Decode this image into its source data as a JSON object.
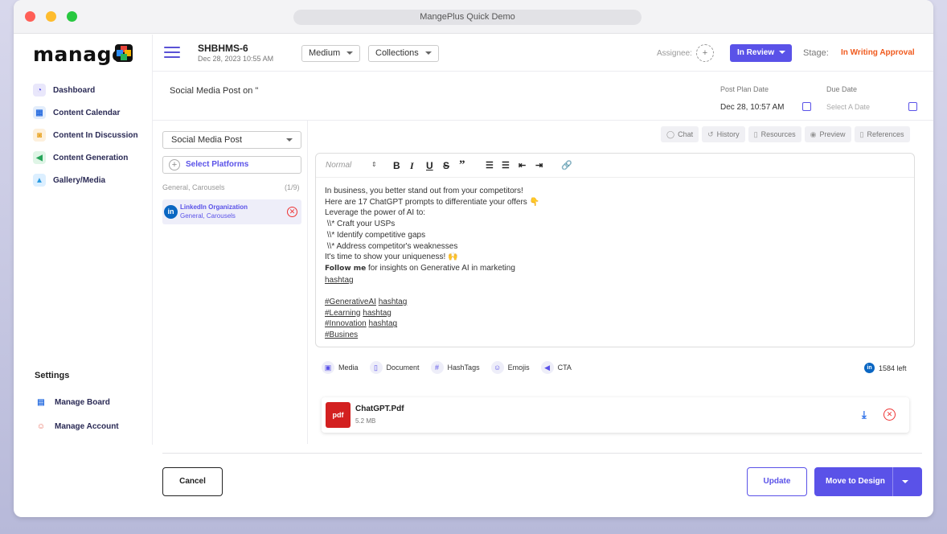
{
  "window": {
    "title": "MangePlus Quick Demo"
  },
  "logo": {
    "text": "manage"
  },
  "sidebar": {
    "items": [
      {
        "label": "Dashboard",
        "icon": "dashboard-icon"
      },
      {
        "label": "Content Calendar",
        "icon": "calendar-icon"
      },
      {
        "label": "Content In Discussion",
        "icon": "chat-bubbles-icon"
      },
      {
        "label": "Content Generation",
        "icon": "megaphone-icon"
      },
      {
        "label": "Gallery/Media",
        "icon": "image-icon"
      }
    ],
    "settings_title": "Settings",
    "settings_items": [
      {
        "label": "Manage Board",
        "icon": "board-icon"
      },
      {
        "label": "Manage Account",
        "icon": "users-icon"
      }
    ]
  },
  "header": {
    "doc_id": "SHBHMS-6",
    "doc_date": "Dec 28, 2023 10:55 AM",
    "priority": "Medium",
    "collection": "Collections",
    "assignee_label": "Assignee:",
    "status": "In Review",
    "stage_label": "Stage:",
    "stage_value": "In Writing Approval"
  },
  "post": {
    "title": "Social Media Post on \"",
    "post_plan_date_label": "Post Plan Date",
    "post_plan_date_value": "Dec 28, 10:57 AM",
    "due_date_label": "Due Date",
    "due_date_placeholder": "Select A Date"
  },
  "left_panel": {
    "content_type": "Social Media Post",
    "select_platforms": "Select Platforms",
    "group_label": "General, Carousels",
    "group_count": "(1/9)",
    "platform": {
      "name": "LinkedIn Organization",
      "sub": "General, Carousels"
    }
  },
  "tabs": [
    {
      "label": "Chat",
      "icon": "chat-icon"
    },
    {
      "label": "History",
      "icon": "history-icon"
    },
    {
      "label": "Resources",
      "icon": "file-icon"
    },
    {
      "label": "Preview",
      "icon": "eye-icon"
    },
    {
      "label": "References",
      "icon": "file-icon"
    }
  ],
  "editor": {
    "format": "Normal",
    "lines": [
      "In business, you better stand out from your competitors!",
      "Here are 17 ChatGPT prompts to differentiate your offers 👇",
      "Leverage the power of AI to:",
      " \\\\* Craft your USPs",
      " \\\\* Identify competitive gaps",
      " \\\\* Address competitor's weaknesses",
      "It's time to show your uniqueness! 🙌"
    ],
    "follow_bold": "Follow me",
    "follow_rest": " for insights on Generative AI in marketing",
    "hashtag_line": "hashtag",
    "tags": [
      {
        "tag": "#GenerativeAI",
        "suffix": "hashtag"
      },
      {
        "tag": "#Learning",
        "suffix": "hashtag"
      },
      {
        "tag": "#Innovation",
        "suffix": "hashtag"
      }
    ],
    "last_tag": "#Busines"
  },
  "attachments": {
    "media": "Media",
    "document": "Document",
    "hashtags": "HashTags",
    "emojis": "Emojis",
    "cta": "CTA",
    "chars_left": "1584 left"
  },
  "file": {
    "name": "ChatGPT.Pdf",
    "size": "5.2 MB",
    "badge": "pdf"
  },
  "footer": {
    "cancel": "Cancel",
    "update": "Update",
    "move": "Move to Design"
  },
  "colors": {
    "accent": "#5a52e8",
    "stage": "#f05a1e",
    "linkedin": "#0a66c2",
    "danger": "#e33333"
  }
}
